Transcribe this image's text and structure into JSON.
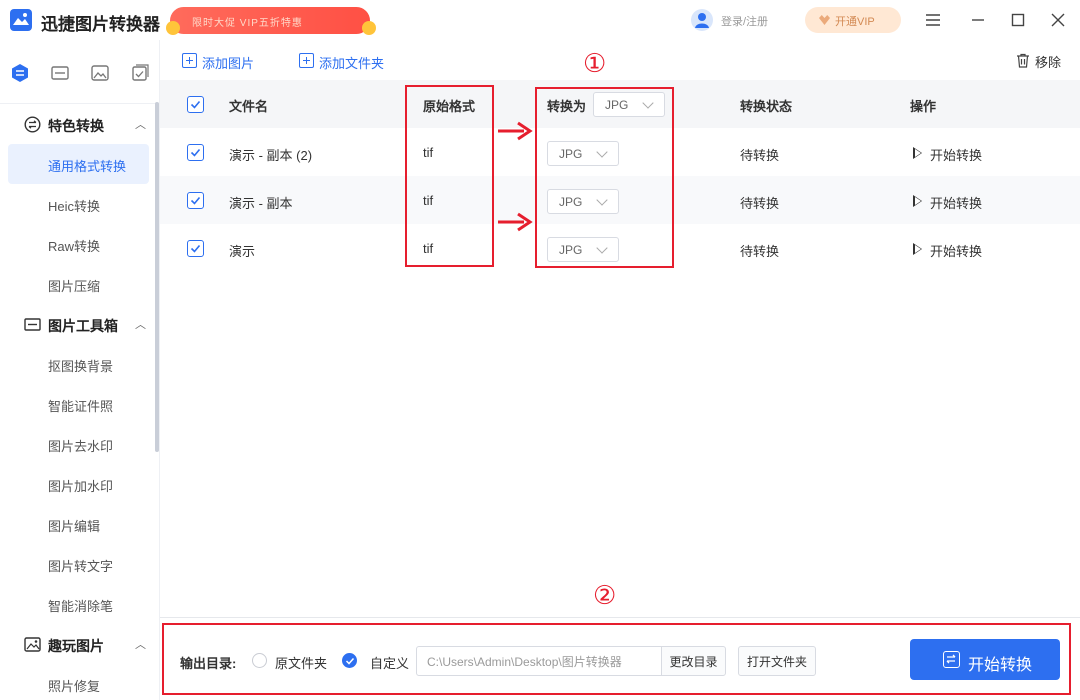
{
  "app": {
    "title": "迅捷图片转换器",
    "promo_text": "限时大促 VIP五折特惠",
    "login_text": "登录/注册",
    "vip_text": "开通VIP"
  },
  "sidebar": {
    "groups": [
      {
        "label": "特色转换",
        "items": [
          "通用格式转换",
          "Heic转换",
          "Raw转换",
          "图片压缩"
        ]
      },
      {
        "label": "图片工具箱",
        "items": [
          "抠图换背景",
          "智能证件照",
          "图片去水印",
          "图片加水印",
          "图片编辑",
          "图片转文字",
          "智能消除笔"
        ]
      },
      {
        "label": "趣玩图片",
        "items": [
          "照片修复"
        ]
      }
    ],
    "active_item": "通用格式转换"
  },
  "toolbar": {
    "add_image": "添加图片",
    "add_folder": "添加文件夹",
    "remove": "移除"
  },
  "table": {
    "headers": {
      "filename": "文件名",
      "source_format": "原始格式",
      "convert_to": "转换为",
      "convert_to_value": "JPG",
      "status": "转换状态",
      "action": "操作"
    },
    "rows": [
      {
        "name": "演示 - 副本 (2)",
        "format": "tif",
        "target": "JPG",
        "status": "待转换",
        "action": "开始转换",
        "checked": true
      },
      {
        "name": "演示 - 副本",
        "format": "tif",
        "target": "JPG",
        "status": "待转换",
        "action": "开始转换",
        "checked": true
      },
      {
        "name": "演示",
        "format": "tif",
        "target": "JPG",
        "status": "待转换",
        "action": "开始转换",
        "checked": true
      }
    ]
  },
  "annotations": {
    "marker_1": "①",
    "marker_2": "②",
    "color": "#e61e2e"
  },
  "output": {
    "label": "输出目录:",
    "option_original": "原文件夹",
    "option_custom": "自定义",
    "selected": "自定义",
    "path": "C:\\Users\\Admin\\Desktop\\图片转换器",
    "change_dir": "更改目录",
    "open_folder": "打开文件夹",
    "start": "开始转换"
  },
  "colors": {
    "accent": "#2d6ff0",
    "sidebar_active_bg": "#eaf1fe",
    "header_bg": "#f5f6f8"
  }
}
